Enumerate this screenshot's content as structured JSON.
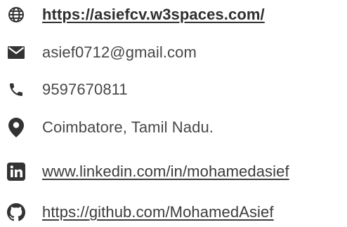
{
  "contacts": {
    "website": {
      "text": "https://asiefcv.w3spaces.com/",
      "icon": "globe-icon"
    },
    "email": {
      "text": "asief0712@gmail.com",
      "icon": "envelope-icon"
    },
    "phone": {
      "text": "9597670811",
      "icon": "phone-icon"
    },
    "location": {
      "text": "Coimbatore, Tamil Nadu.",
      "icon": "map-pin-icon"
    },
    "linkedin": {
      "text": "www.linkedin.com/in/mohamedasief",
      "icon": "linkedin-icon"
    },
    "github": {
      "text": "https://github.com/MohamedAsief",
      "icon": "github-icon"
    }
  },
  "colors": {
    "icon": "#333333",
    "text": "#474747"
  }
}
